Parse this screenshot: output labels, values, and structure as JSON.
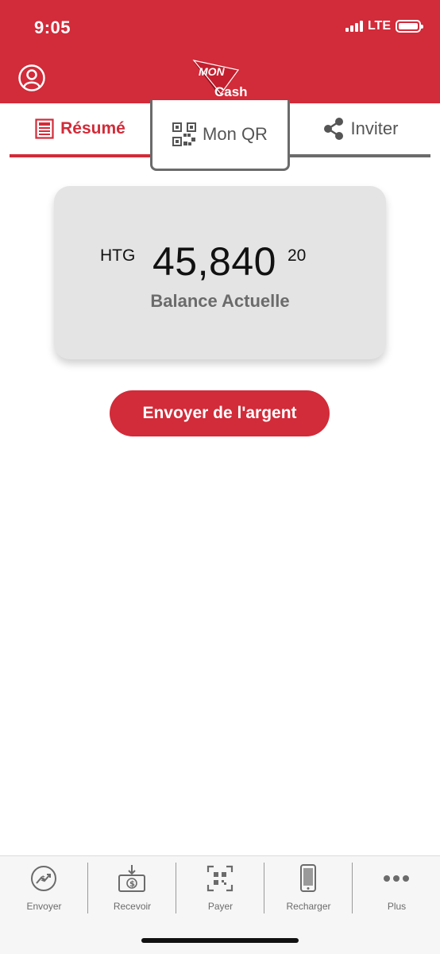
{
  "status_bar": {
    "time": "9:05",
    "network": "LTE"
  },
  "header": {
    "logo_top": "MON",
    "logo_bottom": "Cash"
  },
  "tabs": [
    {
      "label": "Résumé",
      "icon": "document-icon",
      "active": true
    },
    {
      "label": "Mon QR",
      "icon": "qr-code-icon",
      "active": false
    },
    {
      "label": "Inviter",
      "icon": "share-icon",
      "active": false
    }
  ],
  "balance": {
    "currency": "HTG",
    "amount": "45,840",
    "cents": "20",
    "label": "Balance Actuelle"
  },
  "actions": {
    "send_label": "Envoyer de l'argent"
  },
  "bottom_nav": [
    {
      "label": "Envoyer",
      "icon": "send-money-icon"
    },
    {
      "label": "Recevoir",
      "icon": "receive-money-icon"
    },
    {
      "label": "Payer",
      "icon": "scan-qr-icon"
    },
    {
      "label": "Recharger",
      "icon": "phone-icon"
    },
    {
      "label": "Plus",
      "icon": "more-icon"
    }
  ],
  "colors": {
    "brand": "#d22b39",
    "gray": "#6b6b6b",
    "card": "#e4e4e4"
  }
}
